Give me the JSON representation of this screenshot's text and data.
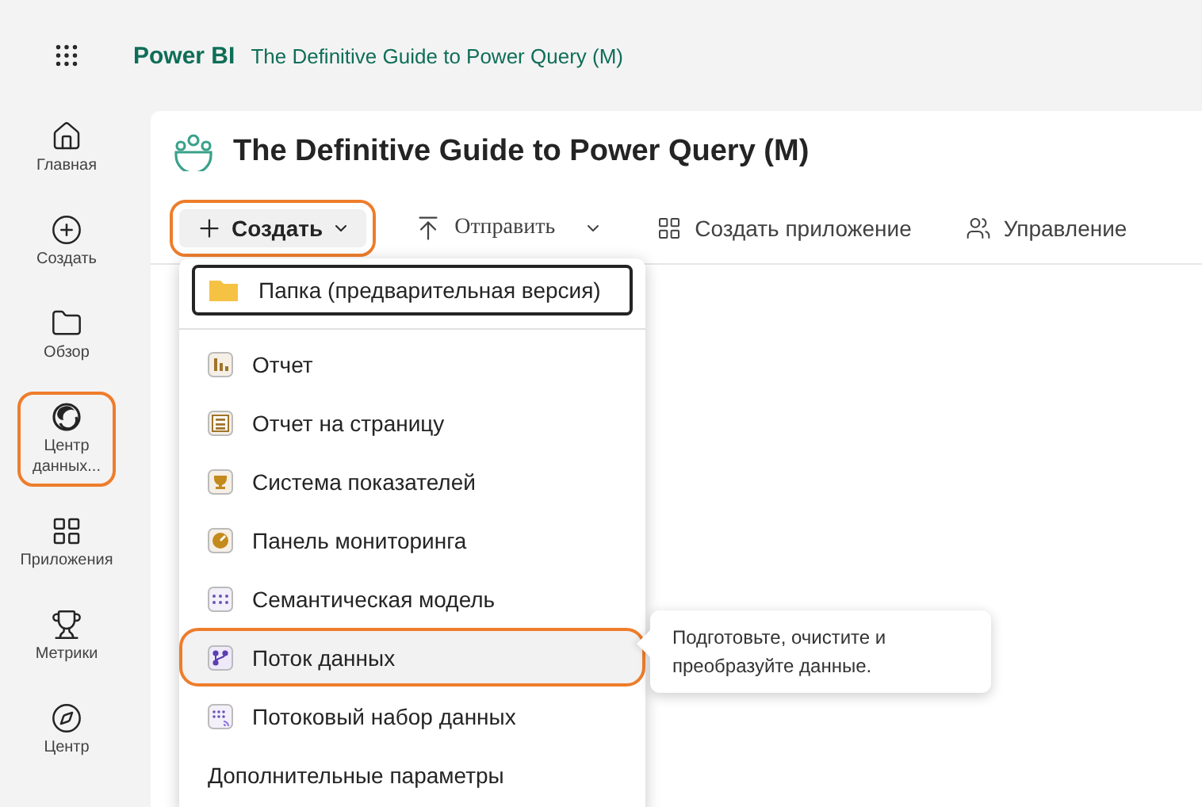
{
  "app": {
    "name": "Power BI",
    "workspace": "The Definitive Guide to Power Query (M)"
  },
  "sidebar": {
    "items": [
      {
        "kind": "home",
        "label": "Главная",
        "highlighted": false
      },
      {
        "kind": "create",
        "label": "Создать",
        "highlighted": false
      },
      {
        "kind": "browse",
        "label": "Обзор",
        "highlighted": false
      },
      {
        "kind": "datahub",
        "label": "Центр данных...",
        "highlighted": true
      },
      {
        "kind": "apps",
        "label": "Приложения",
        "highlighted": false
      },
      {
        "kind": "metrics",
        "label": "Метрики",
        "highlighted": false
      },
      {
        "kind": "center",
        "label": "Центр",
        "highlighted": false
      }
    ]
  },
  "page": {
    "title": "The Definitive Guide to Power Query (M)"
  },
  "toolbar": [
    {
      "kind": "new",
      "label": "Создать",
      "highlighted": true
    },
    {
      "kind": "upload",
      "label": "Отправить",
      "highlighted": false
    },
    {
      "kind": "app",
      "label": "Создать приложение",
      "highlighted": false
    },
    {
      "kind": "manage",
      "label": "Управление",
      "highlighted": false
    }
  ],
  "menu": {
    "items": [
      {
        "kind": "folder",
        "label": "Папка (предварительная версия)",
        "selected": false,
        "focused": true,
        "highlighted": false
      },
      {
        "kind": "report",
        "label": "Отчет",
        "selected": false,
        "focused": false,
        "highlighted": false
      },
      {
        "kind": "paginated",
        "label": "Отчет на страницу",
        "selected": false,
        "focused": false,
        "highlighted": false
      },
      {
        "kind": "scorecard",
        "label": "Система показателей",
        "selected": false,
        "focused": false,
        "highlighted": false
      },
      {
        "kind": "dashboard",
        "label": "Панель мониторинга",
        "selected": false,
        "focused": false,
        "highlighted": false
      },
      {
        "kind": "model",
        "label": "Семантическая модель",
        "selected": false,
        "focused": false,
        "highlighted": false
      },
      {
        "kind": "dataflow",
        "label": "Поток данных",
        "selected": true,
        "focused": false,
        "highlighted": true
      },
      {
        "kind": "streaming",
        "label": "Потоковый набор данных",
        "selected": false,
        "focused": false,
        "highlighted": false
      },
      {
        "kind": "more",
        "label": "Дополнительные параметры",
        "selected": false,
        "focused": false,
        "highlighted": false
      }
    ]
  },
  "tooltip": {
    "text": "Подготовьте, очистите и преобразуйте данные."
  }
}
